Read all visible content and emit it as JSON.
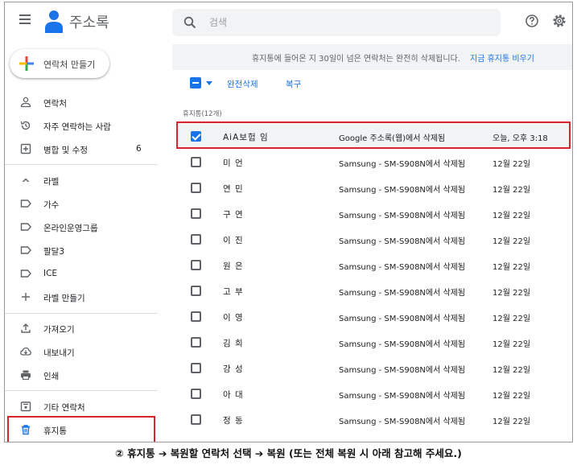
{
  "header": {
    "app_title": "주소록",
    "search_placeholder": "검색",
    "icons": [
      "menu-icon",
      "contacts-logo-icon",
      "search-icon",
      "help-icon",
      "settings-icon"
    ]
  },
  "sidebar": {
    "create_label": "연락처 만들기",
    "items": [
      {
        "label": "연락처",
        "icon": "person-icon"
      },
      {
        "label": "자주 연락하는 사람",
        "icon": "history-icon"
      },
      {
        "label": "병합 및 수정",
        "icon": "merge-icon",
        "count": "6"
      },
      {
        "label": "라벨",
        "icon": "chevron-up-icon"
      },
      {
        "label": "가수",
        "icon": "label-icon"
      },
      {
        "label": "온라인운영그룹",
        "icon": "label-icon"
      },
      {
        "label": "팔달3",
        "icon": "label-icon"
      },
      {
        "label": "ICE",
        "icon": "label-icon"
      },
      {
        "label": "라벨 만들기",
        "icon": "plus-icon"
      },
      {
        "label": "가져오기",
        "icon": "upload-icon"
      },
      {
        "label": "내보내기",
        "icon": "cloud-download-icon"
      },
      {
        "label": "인쇄",
        "icon": "print-icon"
      },
      {
        "label": "기타 연락처",
        "icon": "contact-box-icon"
      },
      {
        "label": "휴지통",
        "icon": "trash-icon"
      }
    ]
  },
  "banner": {
    "text": "휴지통에 들어온 지 30일이 넘은 연락처는 완전히 삭제됩니다.",
    "link": "지금 휴지통 비우기"
  },
  "toolbar": {
    "delete_forever": "완전삭제",
    "restore": "복구"
  },
  "section_label": "휴지통(12개)",
  "rows": [
    {
      "name": "AiA보험 임",
      "source": "Google 주소록(웹)에서 삭제됨",
      "date": "오늘, 오후 3:18",
      "checked": true
    },
    {
      "name": "미 언",
      "source": "Samsung - SM-S908N에서 삭제됨",
      "date": "12월 22일",
      "checked": false
    },
    {
      "name": "연 민",
      "source": "Samsung - SM-S908N에서 삭제됨",
      "date": "12월 22일",
      "checked": false
    },
    {
      "name": "구 연",
      "source": "Samsung - SM-S908N에서 삭제됨",
      "date": "12월 22일",
      "checked": false
    },
    {
      "name": "이 진",
      "source": "Samsung - SM-S908N에서 삭제됨",
      "date": "12월 22일",
      "checked": false
    },
    {
      "name": "원 은",
      "source": "Samsung - SM-S908N에서 삭제됨",
      "date": "12월 22일",
      "checked": false
    },
    {
      "name": "고 부",
      "source": "Samsung - SM-S908N에서 삭제됨",
      "date": "12월 22일",
      "checked": false
    },
    {
      "name": "이 영",
      "source": "Samsung - SM-S908N에서 삭제됨",
      "date": "12월 22일",
      "checked": false
    },
    {
      "name": "김 희",
      "source": "Samsung - SM-S908N에서 삭제됨",
      "date": "12월 22일",
      "checked": false
    },
    {
      "name": "강 성",
      "source": "Samsung - SM-S908N에서 삭제됨",
      "date": "12월 22일",
      "checked": false
    },
    {
      "name": "아 대",
      "source": "Samsung - SM-S908N에서 삭제됨",
      "date": "12월 22일",
      "checked": false
    },
    {
      "name": "정 동",
      "source": "Samsung - SM-S908N에서 삭제됨",
      "date": "12월 22일",
      "checked": false
    }
  ],
  "caption": "② 휴지통 ➔ 복원할 연락처 선택 ➔ 복원 (또는 전체 복원 시 아래 참고해 주세요.)",
  "colors": {
    "accent": "#1a73e8",
    "highlight": "#d9262a",
    "banner_bg": "#f1f3f4"
  }
}
